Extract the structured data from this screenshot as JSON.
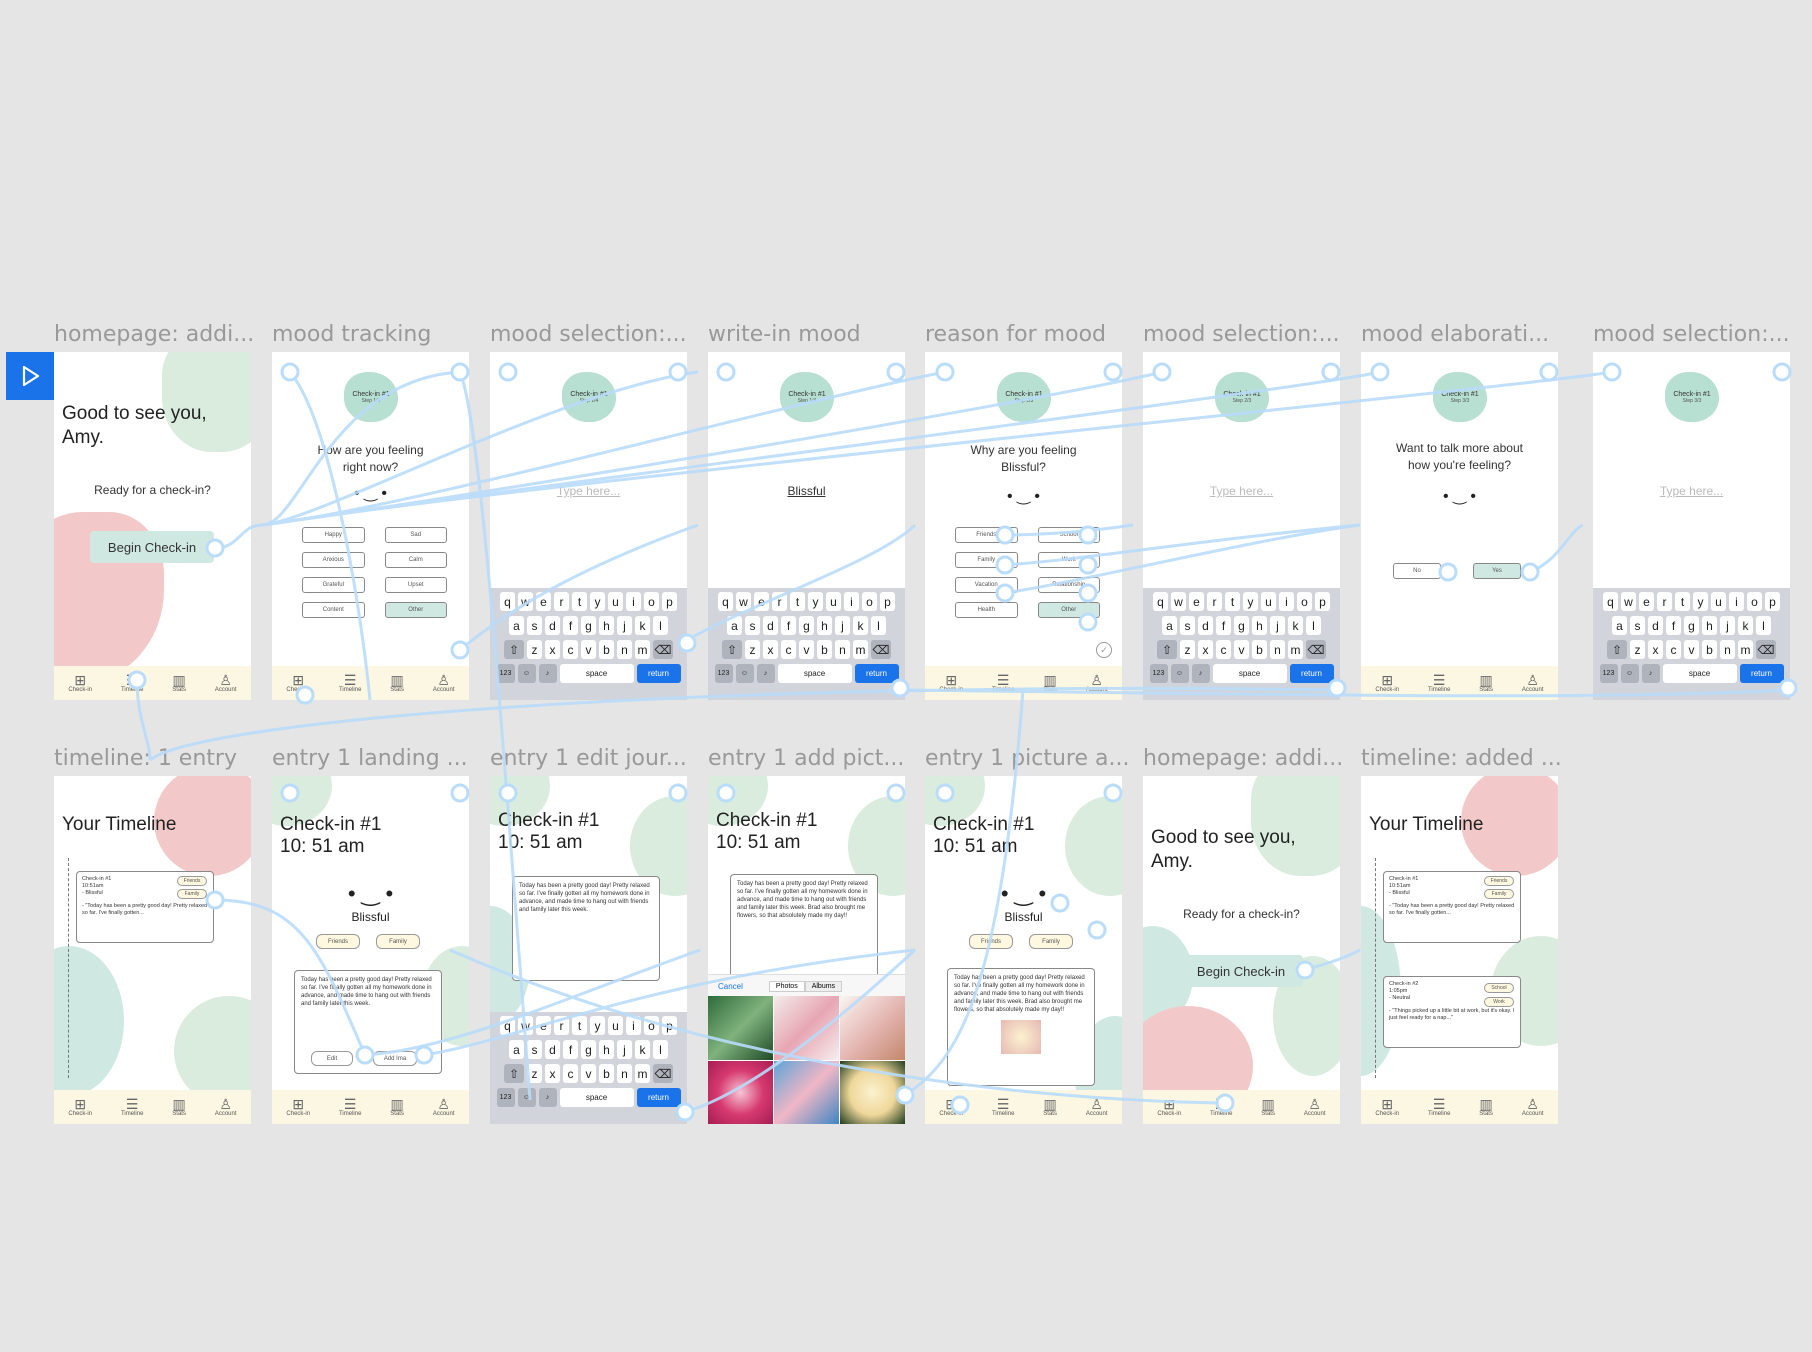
{
  "labels": [
    "homepage: addi...",
    "mood tracking",
    "mood selection:...",
    "write-in mood",
    "reason for mood",
    "mood selection:...",
    "mood elaborati...",
    "mood selection:...",
    "timeline: 1 entry",
    "entry 1 landing ...",
    "entry 1 edit jour...",
    "entry 1 add pict...",
    "entry 1 picture a...",
    "homepage: addi...",
    "timeline: added ..."
  ],
  "tabs": [
    "Check-in",
    "Timeline",
    "Stats",
    "Account"
  ],
  "home": {
    "greeting": "Good to see you, Amy.",
    "ready": "Ready for a check-in?",
    "begin": "Begin Check-in"
  },
  "badge": {
    "title": "Check-in #1",
    "step1": "Step 1/4",
    "step2": "Step 2/3",
    "step3": "Step 3/3"
  },
  "mood": {
    "question": "How are you feeling right now?",
    "face": "• ‿ •",
    "options": [
      "Happy",
      "Sad",
      "Anxious",
      "Calm",
      "Grateful",
      "Upset",
      "Content",
      "Other"
    ]
  },
  "typeHere": "Type here...",
  "blissful": "Blissful",
  "reason": {
    "question": "Why are you feeling Blissful?",
    "options": [
      "Friends",
      "School",
      "Family",
      "Work",
      "Vacation",
      "Relationship",
      "Health",
      "Other"
    ]
  },
  "elaborate": {
    "question": "Want to talk more about how you're feeling?",
    "no": "No",
    "yes": "Yes"
  },
  "keyboard": {
    "row1": [
      "q",
      "w",
      "e",
      "r",
      "t",
      "y",
      "u",
      "i",
      "o",
      "p"
    ],
    "row2": [
      "a",
      "s",
      "d",
      "f",
      "g",
      "h",
      "j",
      "k",
      "l"
    ],
    "row3": [
      "z",
      "x",
      "c",
      "v",
      "b",
      "n",
      "m"
    ],
    "num": "123",
    "space": "space",
    "return": "return"
  },
  "timeline": {
    "title": "Your Timeline"
  },
  "checkin1": {
    "title": "Check-in #1",
    "time": "10:51am",
    "mood": "- Blissful",
    "quote": "- \"Today has been a pretty good day! Pretty relaxed so far. I've finally gotten...",
    "tags": [
      "Friends",
      "Family"
    ]
  },
  "checkin2": {
    "title": "Check-in #2",
    "time": "1:05pm",
    "mood": "- Neutral",
    "quote": "- \"Things picked up a little bit at work, but it's okay. I just feel ready for a nap...\"",
    "tags": [
      "School",
      "Work"
    ]
  },
  "entry": {
    "title": "Check-in #1",
    "time": "10: 51 am",
    "mood": "Blissful",
    "tags": [
      "Friends",
      "Family"
    ],
    "journal": "Today has been a pretty good day! Pretty relaxed so far. I've finally gotten all my homework done in advance, and made time to hang out with friends and family later this week.",
    "journalFull": "Today has been a pretty good day! Pretty relaxed so far. I've finally gotten all my homework done in advance, and made time to hang out with friends and family later this week. Brad also brought me flowers, so that absolutely made my day!!",
    "edit": "Edit",
    "addImage": "Add Ima"
  },
  "picker": {
    "cancel": "Cancel",
    "photos": "Photos",
    "albums": "Albums"
  },
  "colors": {
    "accent": "#cfe9e2",
    "green": "#d9ecdd",
    "pink": "#f2c9c8",
    "tabbar": "#fbf7e3",
    "flow": "#b9dcfa",
    "play": "#1a73e8"
  }
}
